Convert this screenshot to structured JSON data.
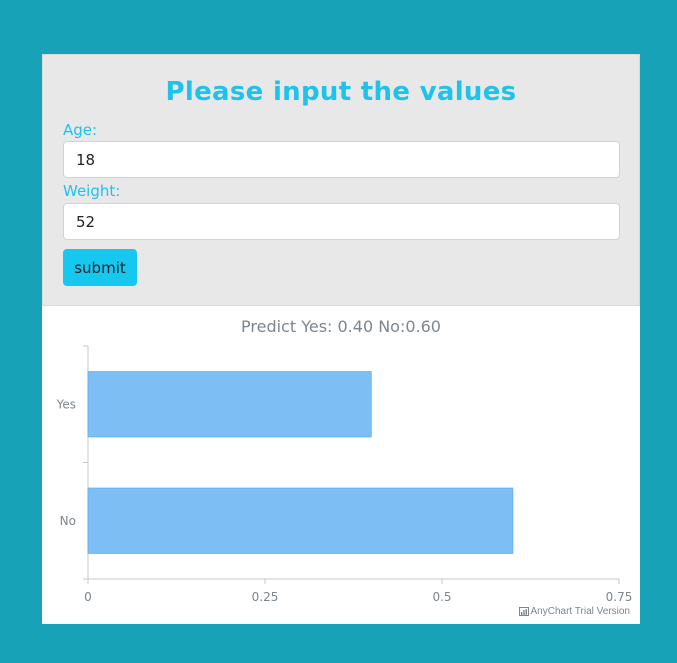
{
  "form": {
    "title": "Please input the values",
    "age_label": "Age:",
    "age_value": "18",
    "weight_label": "Weight:",
    "weight_value": "52",
    "submit_label": "submit"
  },
  "colors": {
    "background": "#17a2b8",
    "accent": "#1ec2ea",
    "button": "#16c7f0",
    "bar_fill": "#7dbff5",
    "bar_stroke": "#64b5f6"
  },
  "watermark": {
    "icon": "bar-chart-icon",
    "text": "AnyChart Trial Version"
  },
  "chart_data": {
    "type": "bar",
    "orientation": "horizontal",
    "title": "Predict Yes: 0.40 No:0.60",
    "categories": [
      "Yes",
      "No"
    ],
    "values": [
      0.4,
      0.6
    ],
    "xlim": [
      0,
      0.75
    ],
    "ticks": [
      "0",
      "0.25",
      "0.5",
      "0.75"
    ],
    "xlabel": "",
    "ylabel": "",
    "grid": false,
    "legend": "none"
  }
}
